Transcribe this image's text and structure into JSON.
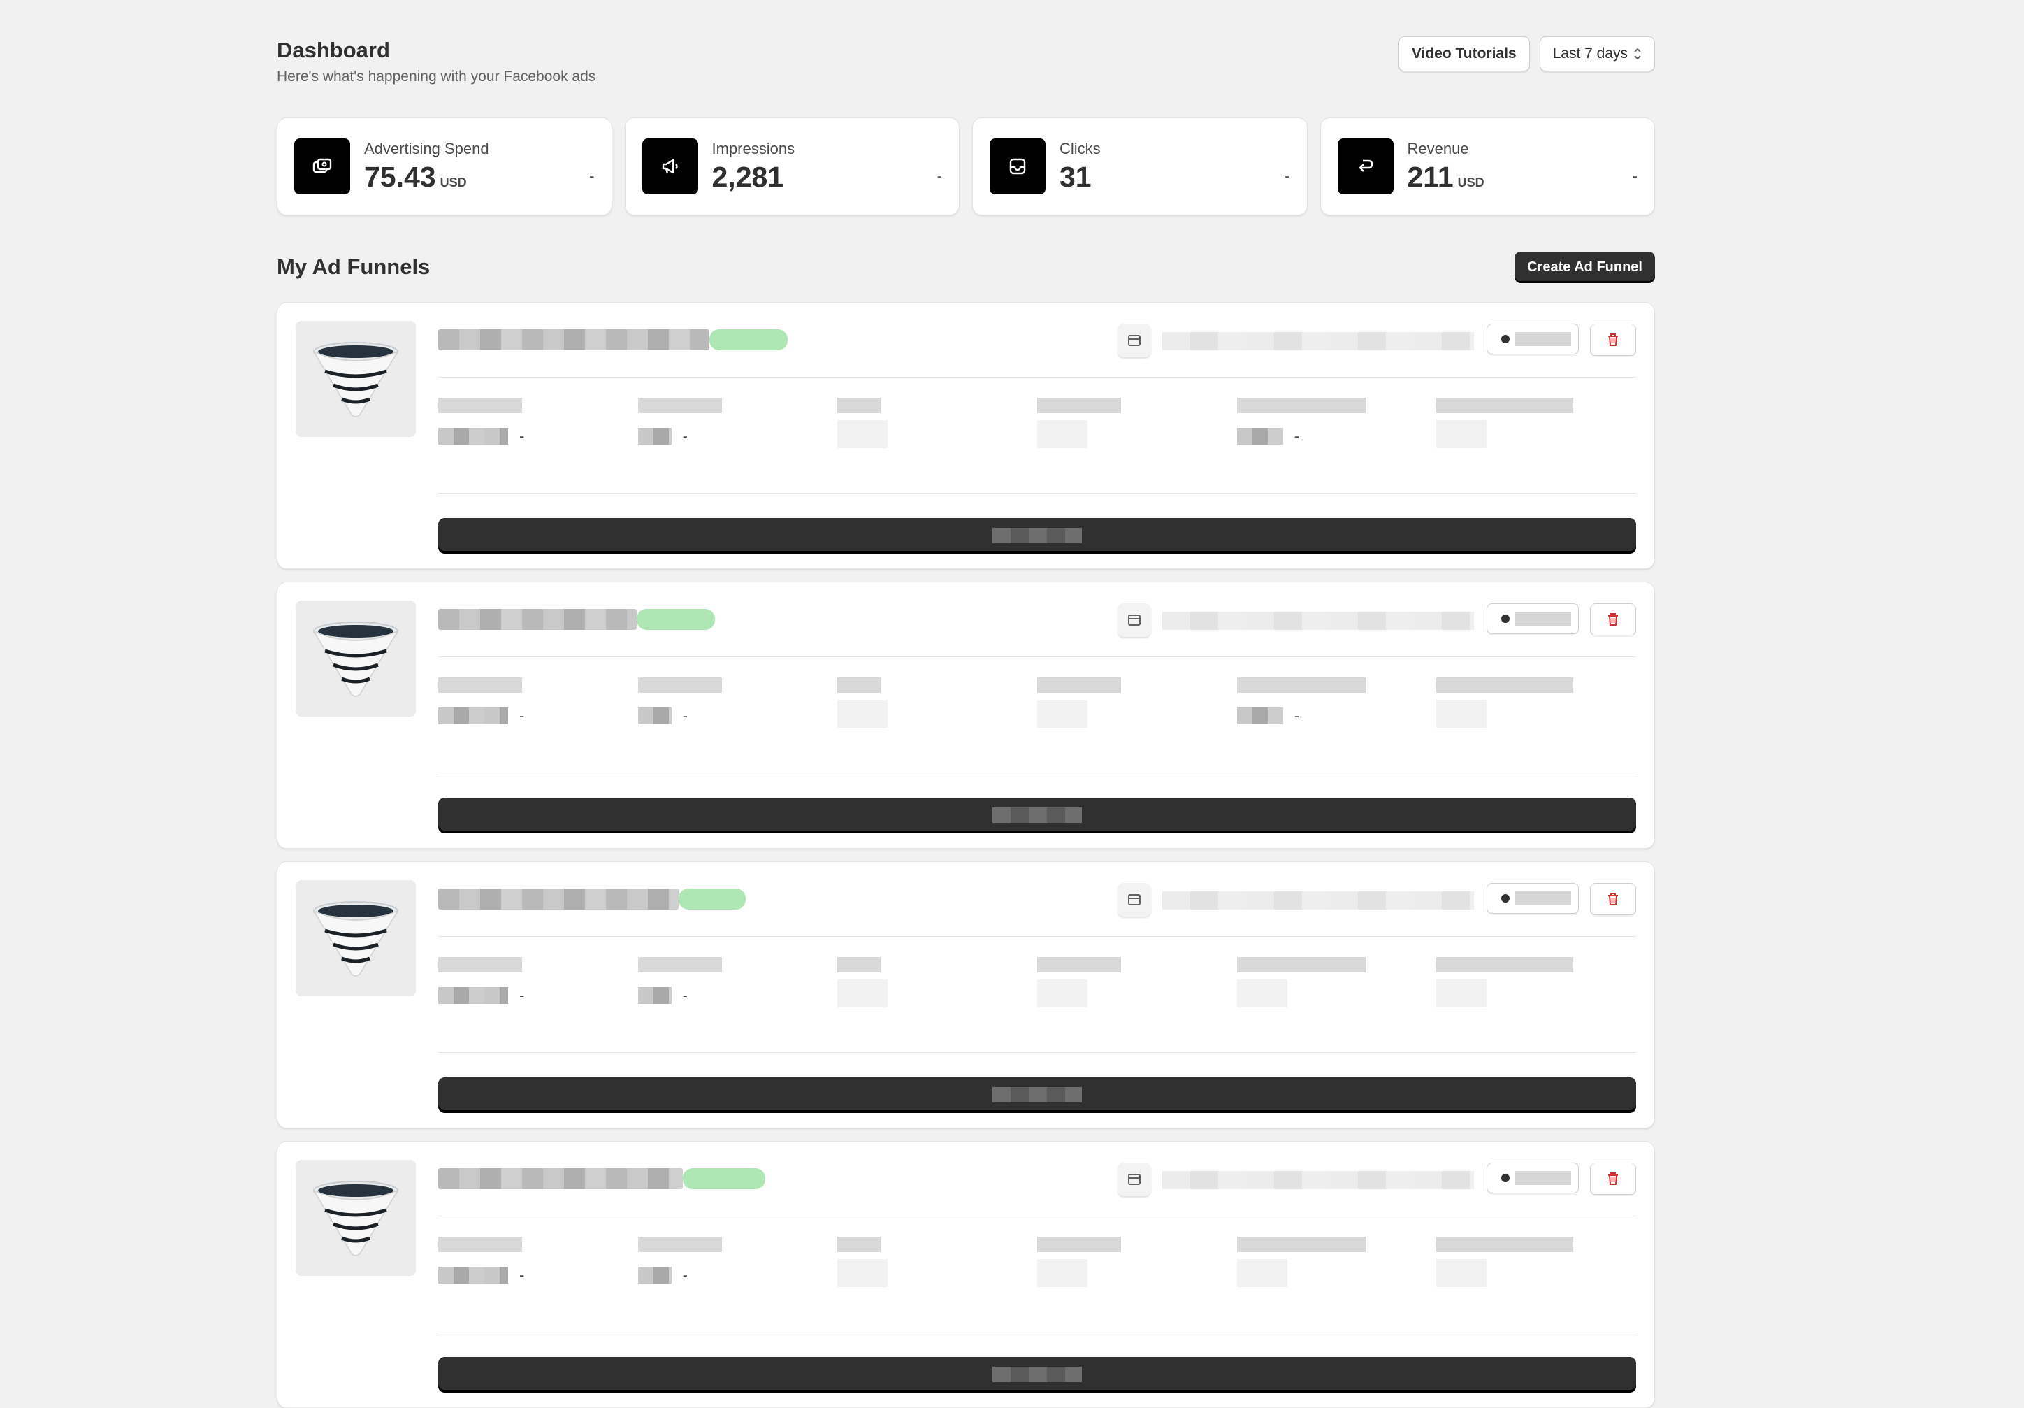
{
  "header": {
    "title": "Dashboard",
    "subtitle": "Here's what's happening with your Facebook ads",
    "video_button": "Video Tutorials",
    "range_select": "Last 7 days"
  },
  "kpis": [
    {
      "label": "Advertising Spend",
      "value": "75.43",
      "unit": "USD",
      "trend": "-",
      "icon": "money-icon"
    },
    {
      "label": "Impressions",
      "value": "2,281",
      "unit": "",
      "trend": "-",
      "icon": "megaphone-icon"
    },
    {
      "label": "Clicks",
      "value": "31",
      "unit": "",
      "trend": "-",
      "icon": "inbox-icon"
    },
    {
      "label": "Revenue",
      "value": "211",
      "unit": "USD",
      "trend": "-",
      "icon": "return-arrow-icon"
    }
  ],
  "section": {
    "title": "My Ad Funnels",
    "create_button": "Create Ad Funnel"
  },
  "funnels": [
    {
      "name": "",
      "status": "",
      "metrics_dash": [
        "-",
        "-",
        "",
        "",
        "-",
        ""
      ]
    },
    {
      "name": "",
      "status": "",
      "metrics_dash": [
        "-",
        "-",
        "",
        "",
        "-",
        ""
      ]
    },
    {
      "name": "",
      "status": "",
      "metrics_dash": [
        "-",
        "-",
        "",
        "",
        "",
        ""
      ]
    },
    {
      "name": "",
      "status": "",
      "metrics_dash": [
        "-",
        "-",
        "",
        "",
        "",
        ""
      ]
    }
  ],
  "colors": {
    "background": "#f1f1f1",
    "primary_button": "#303030",
    "status_pill": "#aee6b4",
    "delete_icon": "#d32f2f"
  }
}
